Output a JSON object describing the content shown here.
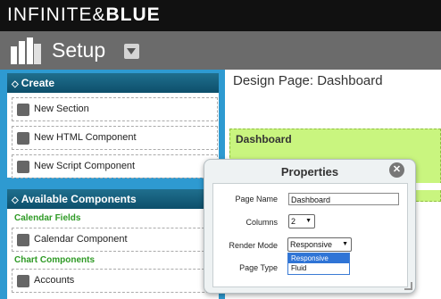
{
  "brand": {
    "name_light": "INFINITE",
    "name_bold": "BLUE",
    "icon": "infinity-icon"
  },
  "header": {
    "title": "Setup",
    "icon": "setup-logo-icon"
  },
  "sidebar": {
    "create": {
      "title": "Create",
      "items": [
        {
          "label": "New Section",
          "icon": "section-icon"
        },
        {
          "label": "New HTML Component",
          "icon": "code-icon"
        },
        {
          "label": "New Script Component",
          "icon": "script-icon"
        }
      ]
    },
    "available": {
      "title": "Available Components",
      "categories": [
        {
          "name": "Calendar Fields",
          "items": [
            {
              "label": "Calendar Component",
              "icon": "cube-icon"
            }
          ]
        },
        {
          "name": "Chart Components",
          "items": [
            {
              "label": "Accounts",
              "icon": "bar-chart-icon"
            }
          ]
        }
      ]
    }
  },
  "main": {
    "title": "Design Page: Dashboard",
    "section_label": "Dashboard"
  },
  "properties": {
    "title": "Properties",
    "close_icon": "close-icon",
    "page_name": {
      "label": "Page Name",
      "value": "Dashboard"
    },
    "columns": {
      "label": "Columns",
      "value": "2"
    },
    "render_mode": {
      "label": "Render Mode",
      "value": "Responsive",
      "options": [
        "Responsive",
        "Fluid"
      ]
    },
    "page_type": {
      "label": "Page Type"
    }
  },
  "colors": {
    "sidebar": "#2e9ad1",
    "panel_header": "#0d4f6b",
    "category": "#2e9a25",
    "section_bg": "#c9f57f",
    "selected_option": "#2f74d6"
  }
}
